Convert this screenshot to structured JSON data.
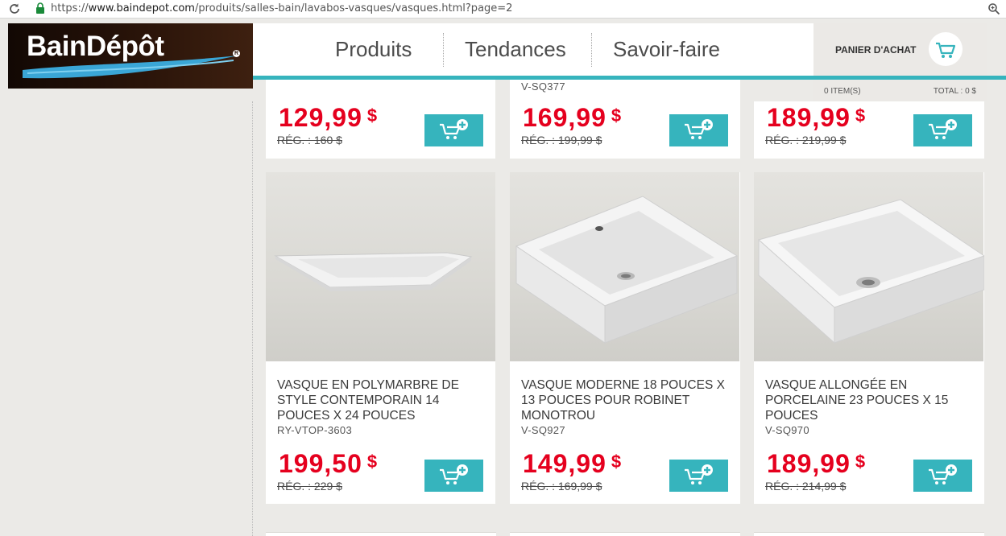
{
  "browser": {
    "url_prefix": "https://",
    "url_host": "www.baindepot.com",
    "url_path": "/produits/salles-bain/lavabos-vasques/vasques.html?page=2"
  },
  "logo": {
    "text": "BainDépôt",
    "mark": "R"
  },
  "nav": {
    "items": [
      "Produits",
      "Tendances",
      "Savoir-faire"
    ]
  },
  "cart": {
    "label": "PANIER D'ACHAT",
    "items": "0 ITEM(S)",
    "total": "TOTAL : 0 $"
  },
  "products_top": [
    {
      "sku": "",
      "price": "129,99",
      "currency": "$",
      "reg_price": "RÉG. : 160 $"
    },
    {
      "sku": "V-SQ377",
      "price": "169,99",
      "currency": "$",
      "reg_price": "RÉG. : 199,99 $"
    },
    {
      "sku": "",
      "price": "189,99",
      "currency": "$",
      "reg_price": "RÉG. : 219,99 $"
    }
  ],
  "products": [
    {
      "title": "VASQUE EN POLYMARBRE DE STYLE CONTEMPORAIN 14 POUCES X 24 POUCES",
      "sku": "RY-VTOP-3603",
      "price": "199,50",
      "currency": "$",
      "reg_price": "RÉG. : 229 $"
    },
    {
      "title": "VASQUE MODERNE 18 POUCES X 13 POUCES POUR ROBINET MONOTROU",
      "sku": "V-SQ927",
      "price": "149,99",
      "currency": "$",
      "reg_price": "RÉG. : 169,99 $"
    },
    {
      "title": "VASQUE ALLONGÉE EN PORCELAINE 23 POUCES X 15 POUCES",
      "sku": "V-SQ970",
      "price": "189,99",
      "currency": "$",
      "reg_price": "RÉG. : 214,99 $"
    }
  ],
  "icons": {
    "reload": "reload-icon",
    "lock": "lock-icon",
    "zoom": "zoom-icon",
    "cart": "cart-icon",
    "add_to_cart": "add-to-cart-icon"
  },
  "colors": {
    "accent": "#36b4bd",
    "price": "#e5001e",
    "page_bg": "#ebeae7"
  }
}
